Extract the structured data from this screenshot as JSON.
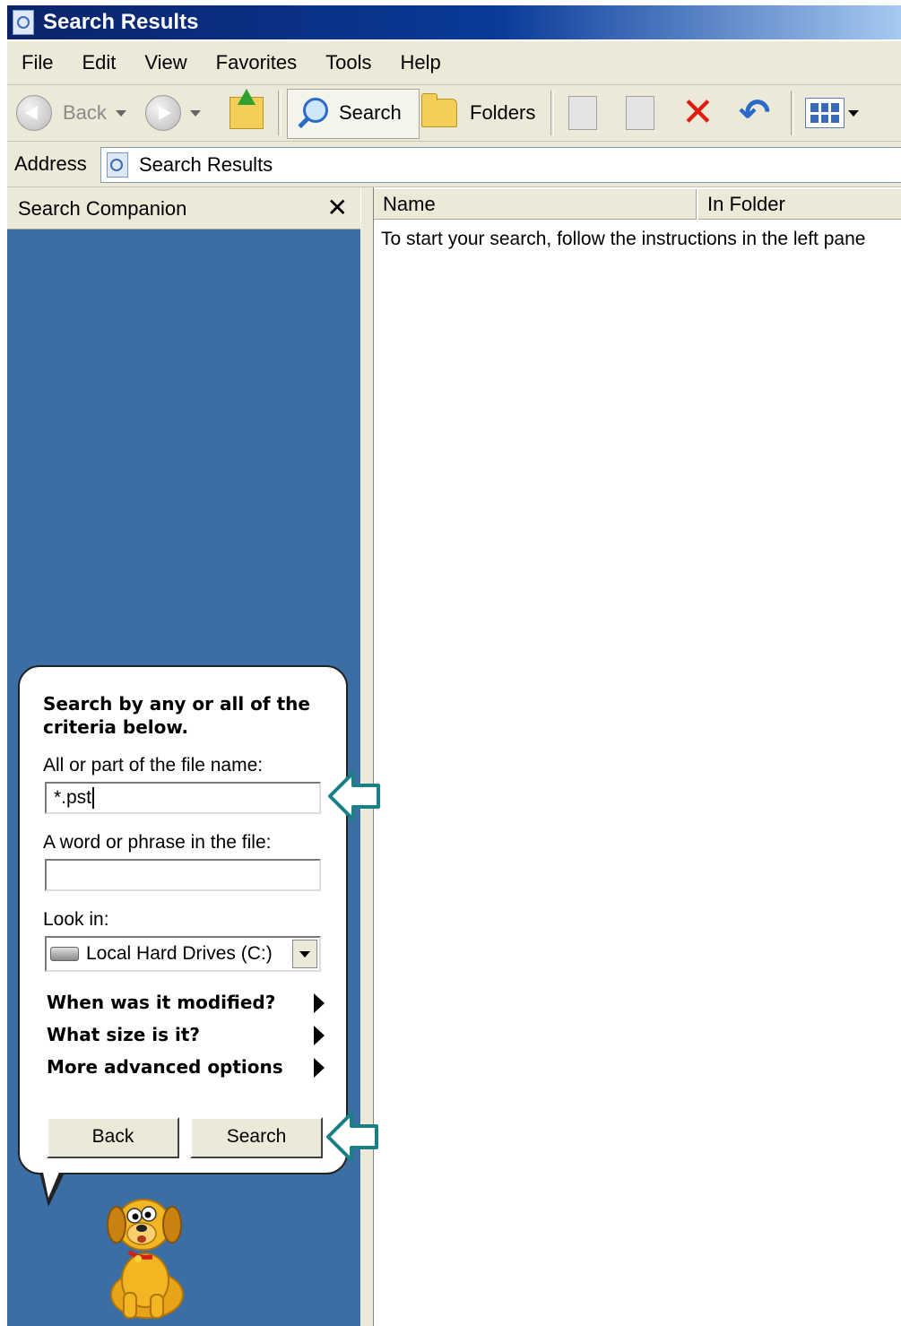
{
  "window": {
    "title": "Search Results"
  },
  "menu": [
    "File",
    "Edit",
    "View",
    "Favorites",
    "Tools",
    "Help"
  ],
  "toolbar": {
    "back_label": "Back",
    "search_label": "Search",
    "folders_label": "Folders"
  },
  "address": {
    "label": "Address",
    "value": "Search Results"
  },
  "left_pane": {
    "title": "Search Companion",
    "close_glyph": "✕"
  },
  "results": {
    "columns": [
      "Name",
      "In Folder"
    ],
    "instructions": "To start your search, follow the instructions in the left pane"
  },
  "search_form": {
    "heading": "Search by any or all of the criteria below.",
    "filename_label": "All or part of the file name:",
    "filename_value": "*.pst",
    "phrase_label": "A word or phrase in the file:",
    "phrase_value": "",
    "lookin_label": "Look in:",
    "lookin_value": "Local Hard Drives (C:)",
    "options": [
      "When was it modified?",
      "What size is it?",
      "More advanced options"
    ],
    "back_button": "Back",
    "search_button": "Search"
  },
  "colors": {
    "pane_blue": "#3a6ea5",
    "title_blue": "#0a246a",
    "chrome": "#ece9d8",
    "callout_teal": "#1a7f86"
  },
  "icons": [
    "page-icon",
    "back-arrow-icon",
    "forward-arrow-icon",
    "up-folder-icon",
    "magnifier-icon",
    "folders-icon",
    "move-to-icon",
    "copy-to-icon",
    "delete-icon",
    "undo-icon",
    "views-icon",
    "drive-icon",
    "dog-icon",
    "callout-arrow-icon"
  ]
}
